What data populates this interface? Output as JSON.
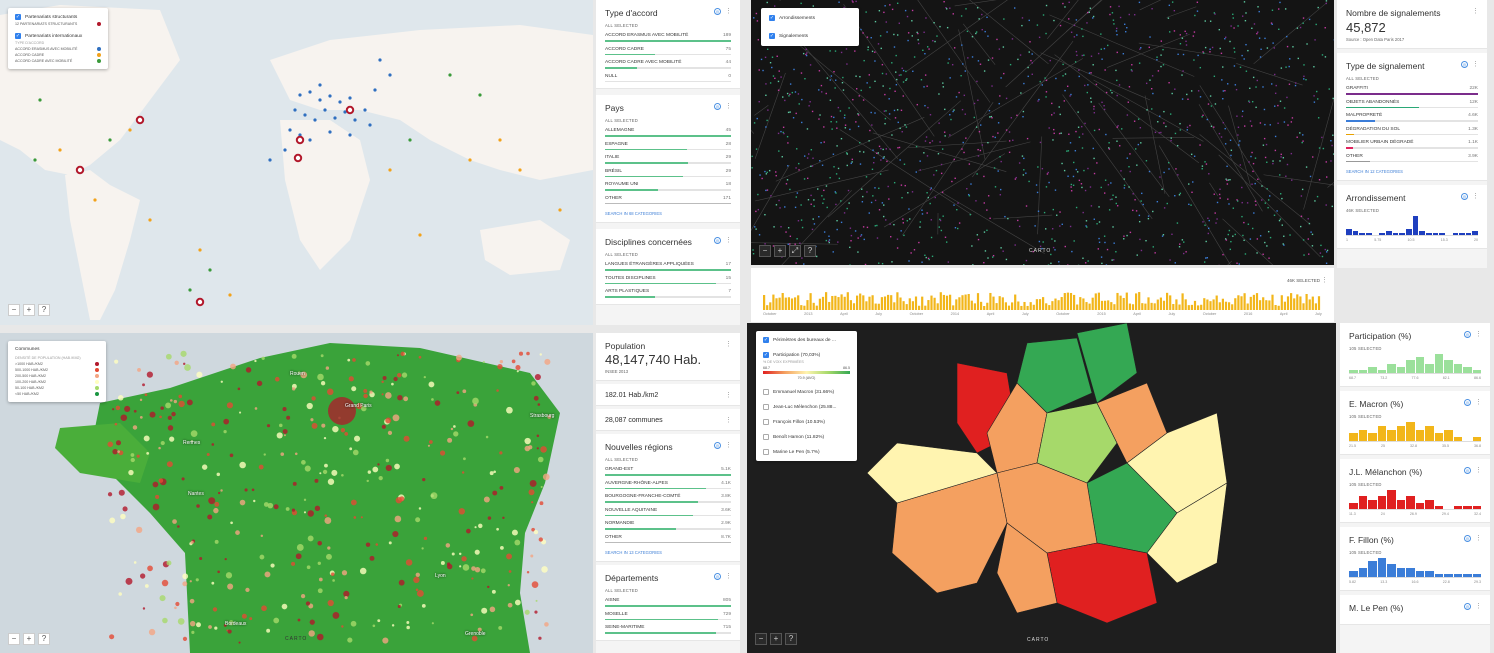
{
  "colors": {
    "accent": "#2f80ed",
    "bar": "#5cc18a"
  },
  "map1": {
    "legend": {
      "layer1": "Partenariats structurants",
      "layer1_sub": "12 PARTENARIATS STRUCTURANTS",
      "layer2": "Partenariats internationaux",
      "layer2_head": "TYPE D'ACCORD",
      "items": [
        {
          "label": "ACCORD ERASMUS AVEC MOBILITÉ",
          "color": "#2f6fc0"
        },
        {
          "label": "ACCORD CADRE",
          "color": "#f2a21a"
        },
        {
          "label": "ACCORD CADRE AVEC MOBILITÉ",
          "color": "#3a9a3a"
        }
      ]
    },
    "zoom": {
      "minus": "−",
      "plus": "+",
      "help": "?"
    }
  },
  "side1": {
    "accord": {
      "title": "Type d'accord",
      "sub": "ALL SELECTED",
      "rows": [
        {
          "label": "ACCORD ERASMUS AVEC MOBILITÉ",
          "value": "189",
          "pct": 1.0
        },
        {
          "label": "ACCORD CADRE",
          "value": "75",
          "pct": 0.4
        },
        {
          "label": "ACCORD CADRE AVEC MOBILITÉ",
          "value": "44",
          "pct": 0.25
        },
        {
          "label": "NULL",
          "value": "0",
          "pct": 0.0
        }
      ]
    },
    "pays": {
      "title": "Pays",
      "sub": "ALL SELECTED",
      "rows": [
        {
          "label": "ALLEMAGNE",
          "value": "45",
          "pct": 1.0
        },
        {
          "label": "ESPAGNE",
          "value": "28",
          "pct": 0.65
        },
        {
          "label": "ITALIE",
          "value": "29",
          "pct": 0.66
        },
        {
          "label": "BRÉSIL",
          "value": "29",
          "pct": 0.62
        },
        {
          "label": "ROYAUME UNI",
          "value": "18",
          "pct": 0.42
        },
        {
          "label": "OTHER",
          "value": "171",
          "pct": 1.0,
          "grey": true
        }
      ],
      "link": "SEARCH IN 68 CATEGORIES"
    },
    "disc": {
      "title": "Disciplines concernées",
      "sub": "ALL SELECTED",
      "rows": [
        {
          "label": "LANGUES ÉTRANGÈRES APPLIQUÉES",
          "value": "17",
          "pct": 1.0
        },
        {
          "label": "TOUTES DISCIPLINES",
          "value": "15",
          "pct": 0.88
        },
        {
          "label": "ARTS PLASTIQUES",
          "value": "7",
          "pct": 0.4
        }
      ]
    }
  },
  "map2": {
    "legend": {
      "layer1": "Arrondissements",
      "layer2": "Signalements"
    },
    "carto": "CARTO",
    "zoom": {
      "minus": "−",
      "plus": "+",
      "c1": "⤢",
      "c2": "?"
    }
  },
  "timeline": {
    "selected": "46K SELECTED",
    "ticks": [
      "October",
      "2013",
      "April",
      "July",
      "October",
      "2014",
      "April",
      "July",
      "October",
      "2015",
      "April",
      "July",
      "October",
      "2016",
      "April",
      "July"
    ]
  },
  "side2": {
    "count": {
      "title": "Nombre de signalements",
      "value": "45,872",
      "source": "Source : Open Data Paris 2017"
    },
    "type": {
      "title": "Type de signalement",
      "sub": "ALL SELECTED",
      "rows": [
        {
          "label": "GRAFFITI",
          "value": "22k",
          "pct": 1.0,
          "color": "#7b2d8b"
        },
        {
          "label": "OBJETS ABANDONNÉS",
          "value": "12k",
          "pct": 0.55,
          "color": "#2aa876"
        },
        {
          "label": "MALPROPRETÉ",
          "value": "4.6k",
          "pct": 0.22,
          "color": "#3b7dd8"
        },
        {
          "label": "DÉGRADATION DU SOL",
          "value": "1.3k",
          "pct": 0.06,
          "color": "#e8a100"
        },
        {
          "label": "MOBILIER URBAIN DÉGRADÉ",
          "value": "1.1k",
          "pct": 0.05,
          "color": "#e0245e"
        },
        {
          "label": "OTHER",
          "value": "3.9k",
          "pct": 0.18,
          "color": "#999"
        }
      ],
      "link": "SEARCH IN 12 CATEGORIES"
    },
    "arr": {
      "title": "Arrondissement",
      "sub": "46K SELECTED",
      "values": [
        3,
        2,
        1,
        1,
        0,
        1,
        2,
        1,
        1,
        3,
        10,
        2,
        1,
        1,
        1,
        0,
        1,
        1,
        1,
        2
      ],
      "ticks": [
        "1",
        "5.75",
        "10.5",
        "15.3",
        "20"
      ]
    }
  },
  "map3": {
    "legend": {
      "title": "Communes",
      "head": "DENSITÉ DE POPULATION (HAB./KM2)",
      "items": [
        {
          "label": ">1000 HAB./KM2",
          "color": "#b2182b"
        },
        {
          "label": "500-1000 HAB./KM2",
          "color": "#e34a33"
        },
        {
          "label": "200-500 HAB./KM2",
          "color": "#f4a582"
        },
        {
          "label": "100-200 HAB./KM2",
          "color": "#ffffbf"
        },
        {
          "label": "50-100 HAB./KM2",
          "color": "#a6d96a"
        },
        {
          "label": "<50 HAB./KM2",
          "color": "#1a9641"
        }
      ]
    },
    "cities": [
      "Rouen",
      "Grand Paris",
      "Strasbourg",
      "Rennes",
      "Nantes",
      "Lyon",
      "Grenoble",
      "Bordeaux"
    ],
    "carto": "CARTO",
    "zoom": {
      "minus": "−",
      "plus": "+",
      "help": "?"
    }
  },
  "side3": {
    "pop": {
      "title": "Population",
      "value": "48,147,740 Hab.",
      "source": "INSEE 2013"
    },
    "dens": {
      "value": "182.01 Hab./km2"
    },
    "comm": {
      "value": "28,087 communes"
    },
    "reg": {
      "title": "Nouvelles régions",
      "sub": "ALL SELECTED",
      "rows": [
        {
          "label": "GRAND-EST",
          "value": "5.1k",
          "pct": 1.0
        },
        {
          "label": "AUVERGNE-RHÔNE-ALPES",
          "value": "4.1k",
          "pct": 0.8
        },
        {
          "label": "BOURGOGNE-FRANCHE-COMTÉ",
          "value": "3.8k",
          "pct": 0.74
        },
        {
          "label": "NOUVELLE AQUITAINE",
          "value": "3.6k",
          "pct": 0.7
        },
        {
          "label": "NORMANDIE",
          "value": "2.9k",
          "pct": 0.56
        },
        {
          "label": "OTHER",
          "value": "8.7k",
          "pct": 1.0,
          "grey": true
        }
      ],
      "link": "SEARCH IN 13 CATEGORIES"
    },
    "dep": {
      "title": "Départements",
      "sub": "ALL SELECTED",
      "rows": [
        {
          "label": "AISNE",
          "value": "805",
          "pct": 1.0
        },
        {
          "label": "MOSELLE",
          "value": "729",
          "pct": 0.9
        },
        {
          "label": "SEINE-MARITIME",
          "value": "715",
          "pct": 0.88
        }
      ]
    }
  },
  "map4": {
    "legend": {
      "layer1": "Périmètres des bureaux de ...",
      "layer2": "Participation (70,03%)",
      "grad_head": "% DE VOIX EXPRIMÉES",
      "grad_min": "68.7",
      "grad_max": "86.5",
      "grad_avg": "70.9 (AVG)",
      "cands": [
        "Emmanuel Macron (31.66%)",
        "Jean-Luc Mélenchon (25.88...",
        "François Fillon (10.53%)",
        "Benoît Hamon (11.82%)",
        "Marine Le Pen (5.7%)"
      ]
    },
    "carto": "CARTO",
    "zoom": {
      "minus": "−",
      "plus": "+",
      "help": "?"
    }
  },
  "side4": {
    "hists": [
      {
        "title": "Participation (%)",
        "sub": "105 SELECTED",
        "color": "#9be09b",
        "values": [
          1,
          1,
          2,
          1,
          3,
          2,
          4,
          5,
          3,
          6,
          4,
          3,
          2,
          1
        ],
        "ticks": [
          "68.7",
          "73.2",
          "77.6",
          "82.1",
          "86.6"
        ]
      },
      {
        "title": "E. Macron (%)",
        "sub": "105 SELECTED",
        "color": "#f2b61a",
        "values": [
          2,
          3,
          2,
          4,
          3,
          4,
          5,
          3,
          4,
          2,
          3,
          1,
          0,
          1
        ],
        "ticks": [
          "21.5",
          "25",
          "32.8",
          "35.5",
          "36.8"
        ]
      },
      {
        "title": "J.L. Mélanchon (%)",
        "sub": "105 SELECTED",
        "color": "#e02020",
        "values": [
          2,
          4,
          3,
          4,
          6,
          3,
          4,
          2,
          3,
          1,
          0,
          1,
          1,
          1
        ],
        "ticks": [
          "11.3",
          "24",
          "26.9",
          "29.4",
          "32.4"
        ]
      },
      {
        "title": "F. Fillon (%)",
        "sub": "105 SELECTED",
        "color": "#3b7dd8",
        "values": [
          2,
          3,
          5,
          6,
          4,
          3,
          3,
          2,
          2,
          1,
          1,
          1,
          1,
          1
        ],
        "ticks": [
          "5.82",
          "13.3",
          "16.6",
          "22.8",
          "29.3"
        ]
      }
    ],
    "last": {
      "title": "M. Le Pen (%)"
    }
  }
}
